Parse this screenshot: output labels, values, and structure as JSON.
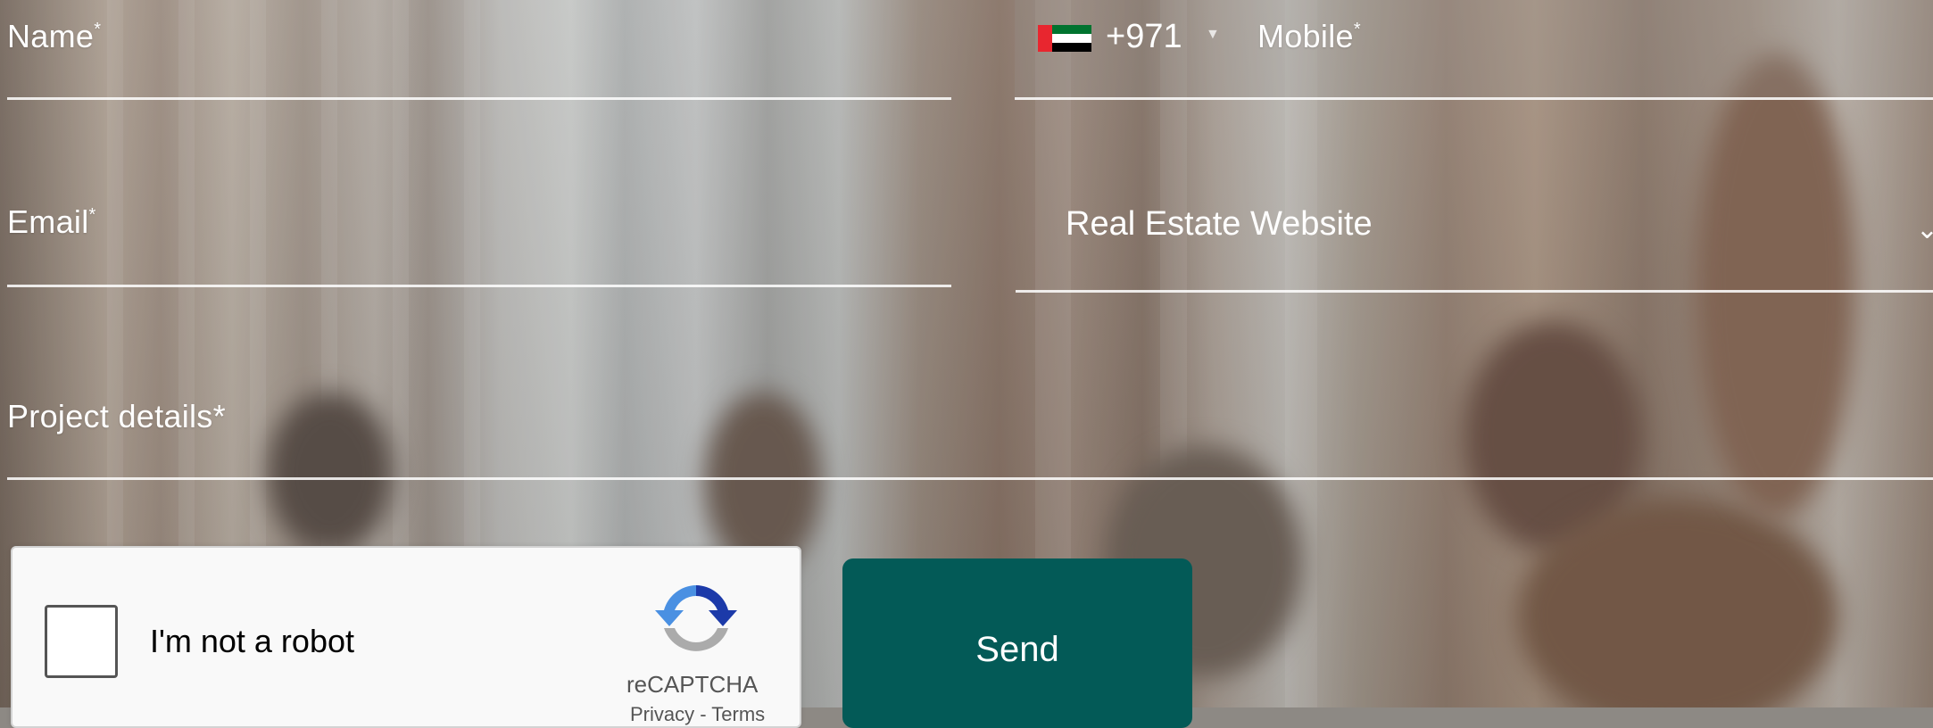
{
  "form": {
    "name": {
      "label": "Name",
      "required_mark": "*"
    },
    "mobile": {
      "country_code": "+971",
      "label": "Mobile",
      "required_mark": "*"
    },
    "email": {
      "label": "Email",
      "required_mark": "*"
    },
    "service": {
      "selected": "Real Estate Website"
    },
    "project_details": {
      "label": "Project details*"
    },
    "recaptcha": {
      "checkbox_label": "I'm not a robot",
      "brand": "reCAPTCHA",
      "links": "Privacy - Terms"
    },
    "send_label": "Send"
  },
  "colors": {
    "button": "#035a57",
    "field_text": "#ffffff",
    "flag_red": "#e8262f",
    "flag_green": "#00732f",
    "flag_white": "#ffffff",
    "flag_black": "#000000"
  },
  "icons": {
    "flag": "uae-flag-icon",
    "caret": "caret-down-icon",
    "select_arrow": "chevron-down-icon",
    "recaptcha_logo": "recaptcha-logo-icon"
  }
}
